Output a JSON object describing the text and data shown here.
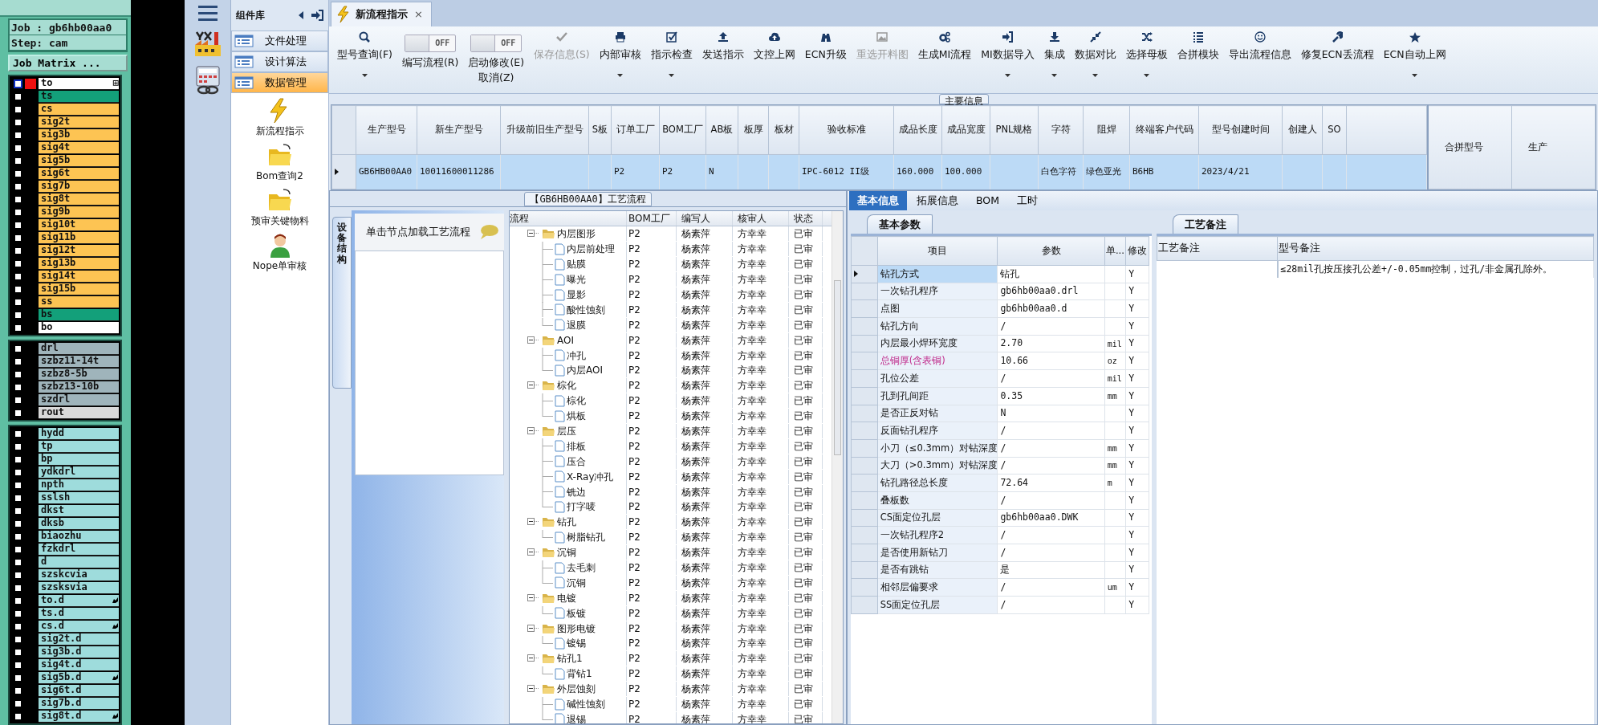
{
  "cam": {
    "job": "Job : gb6hb00aa0",
    "step": "Step: cam",
    "matrix_button": "Job Matrix ...",
    "layer_groups": [
      [
        {
          "name": "to",
          "color": "#ffffff",
          "checked": false,
          "active": true,
          "marked": false,
          "expand": "⊞"
        },
        {
          "name": "ts",
          "color": "#13a07a",
          "checked": false,
          "active": false,
          "marked": false
        },
        {
          "name": "cs",
          "color": "#fdc453",
          "checked": false,
          "active": false,
          "marked": false
        },
        {
          "name": "sig2t",
          "color": "#fdc453",
          "checked": false,
          "active": false,
          "marked": false
        },
        {
          "name": "sig3b",
          "color": "#fdc453",
          "checked": false,
          "active": false,
          "marked": false
        },
        {
          "name": "sig4t",
          "color": "#fdc453",
          "checked": false,
          "active": false,
          "marked": false
        },
        {
          "name": "sig5b",
          "color": "#fdc453",
          "checked": false,
          "active": false,
          "marked": false
        },
        {
          "name": "sig6t",
          "color": "#fdc453",
          "checked": false,
          "active": false,
          "marked": false
        },
        {
          "name": "sig7b",
          "color": "#fdc453",
          "checked": false,
          "active": false,
          "marked": false
        },
        {
          "name": "sig8t",
          "color": "#fdc453",
          "checked": false,
          "active": false,
          "marked": false
        },
        {
          "name": "sig9b",
          "color": "#fdc453",
          "checked": false,
          "active": false,
          "marked": false
        },
        {
          "name": "sig10t",
          "color": "#fdc453",
          "checked": false,
          "active": false,
          "marked": false
        },
        {
          "name": "sig11b",
          "color": "#fdc453",
          "checked": false,
          "active": false,
          "marked": false
        },
        {
          "name": "sig12t",
          "color": "#fdc453",
          "checked": false,
          "active": false,
          "marked": false
        },
        {
          "name": "sig13b",
          "color": "#fdc453",
          "checked": false,
          "active": false,
          "marked": false
        },
        {
          "name": "sig14t",
          "color": "#fdc453",
          "checked": false,
          "active": false,
          "marked": false
        },
        {
          "name": "sig15b",
          "color": "#fdc453",
          "checked": false,
          "active": false,
          "marked": false
        },
        {
          "name": "ss",
          "color": "#fdc453",
          "checked": false,
          "active": false,
          "marked": false
        },
        {
          "name": "bs",
          "color": "#13a07a",
          "checked": false,
          "active": false,
          "marked": false
        },
        {
          "name": "bo",
          "color": "#ffffff",
          "checked": false,
          "active": false,
          "marked": false
        }
      ],
      [
        {
          "name": "drl",
          "color": "#9fb4bb",
          "checked": false,
          "active": false,
          "marked": false
        },
        {
          "name": "szbz11-14t",
          "color": "#9fb4bb",
          "checked": false,
          "active": false,
          "marked": false
        },
        {
          "name": "szbz8-5b",
          "color": "#9fb4bb",
          "checked": false,
          "active": false,
          "marked": false
        },
        {
          "name": "szbz13-10b",
          "color": "#9fb4bb",
          "checked": false,
          "active": false,
          "marked": false
        },
        {
          "name": "szdrl",
          "color": "#9fb4bb",
          "checked": false,
          "active": false,
          "marked": false
        },
        {
          "name": "rout",
          "color": "#d9d9d9",
          "checked": false,
          "active": false,
          "marked": false
        }
      ],
      [
        {
          "name": "hydd",
          "color": "#9edcdc",
          "checked": false,
          "active": false,
          "marked": false
        },
        {
          "name": "tp",
          "color": "#9edcdc",
          "checked": false,
          "active": false,
          "marked": false
        },
        {
          "name": "bp",
          "color": "#9edcdc",
          "checked": false,
          "active": false,
          "marked": false
        },
        {
          "name": "ydkdrl",
          "color": "#9edcdc",
          "checked": false,
          "active": false,
          "marked": false
        },
        {
          "name": "npth",
          "color": "#9edcdc",
          "checked": false,
          "active": false,
          "marked": false
        },
        {
          "name": "sslsh",
          "color": "#9edcdc",
          "checked": false,
          "active": false,
          "marked": false
        },
        {
          "name": "dkst",
          "color": "#9edcdc",
          "checked": false,
          "active": false,
          "marked": false
        },
        {
          "name": "dksb",
          "color": "#9edcdc",
          "checked": false,
          "active": false,
          "marked": false
        },
        {
          "name": "biaozhu",
          "color": "#9edcdc",
          "checked": false,
          "active": false,
          "marked": false
        },
        {
          "name": "fzkdrl",
          "color": "#9edcdc",
          "checked": false,
          "active": false,
          "marked": false
        },
        {
          "name": "d",
          "color": "#9edcdc",
          "checked": false,
          "active": false,
          "marked": false
        },
        {
          "name": "szskcvia",
          "color": "#9edcdc",
          "checked": false,
          "active": false,
          "marked": false
        },
        {
          "name": "szsksvia",
          "color": "#9edcdc",
          "checked": false,
          "active": false,
          "marked": false
        },
        {
          "name": "to.d",
          "color": "#9edcdc",
          "checked": false,
          "active": false,
          "marked": true
        },
        {
          "name": "ts.d",
          "color": "#9edcdc",
          "checked": false,
          "active": false,
          "marked": false
        },
        {
          "name": "cs.d",
          "color": "#9edcdc",
          "checked": false,
          "active": false,
          "marked": true
        },
        {
          "name": "sig2t.d",
          "color": "#9edcdc",
          "checked": false,
          "active": false,
          "marked": false
        },
        {
          "name": "sig3b.d",
          "color": "#9edcdc",
          "checked": false,
          "active": false,
          "marked": false
        },
        {
          "name": "sig4t.d",
          "color": "#9edcdc",
          "checked": false,
          "active": false,
          "marked": false
        },
        {
          "name": "sig5b.d",
          "color": "#9edcdc",
          "checked": false,
          "active": false,
          "marked": true
        },
        {
          "name": "sig6t.d",
          "color": "#9edcdc",
          "checked": false,
          "active": false,
          "marked": false
        },
        {
          "name": "sig7b.d",
          "color": "#9edcdc",
          "checked": false,
          "active": false,
          "marked": false
        },
        {
          "name": "sig8t.d",
          "color": "#9edcdc",
          "checked": false,
          "active": false,
          "marked": true
        }
      ]
    ]
  },
  "component_library": {
    "title": "组件库",
    "categories": [
      {
        "label": "文件处理",
        "selected": false
      },
      {
        "label": "设计算法",
        "selected": false
      },
      {
        "label": "数据管理",
        "selected": true
      }
    ],
    "modules": [
      {
        "label": "新流程指示"
      },
      {
        "label": "Bom查询2"
      },
      {
        "label": "预审关键物料"
      },
      {
        "label": "Nope单审核"
      }
    ]
  },
  "tabs": [
    {
      "label": "新流程指示",
      "selected": true,
      "close": "×"
    }
  ],
  "toolbar": [
    {
      "kind": "button",
      "label": "型号查询(F)",
      "dropdown": true,
      "disabled": false
    },
    {
      "kind": "toggle",
      "label": "编写流程(R)",
      "switch_text": "OFF",
      "on": false
    },
    {
      "kind": "toggle",
      "label": "启动修改(E)",
      "label2": "取消(Z)",
      "switch_text": "OFF",
      "on": false
    },
    {
      "kind": "button",
      "label": "保存信息(S)",
      "dropdown": false,
      "disabled": true
    },
    {
      "kind": "button",
      "label": "内部审核",
      "dropdown": true,
      "disabled": false
    },
    {
      "kind": "button",
      "label": "指示检查",
      "dropdown": true,
      "disabled": false
    },
    {
      "kind": "button",
      "label": "发送指示",
      "dropdown": false,
      "disabled": false
    },
    {
      "kind": "button",
      "label": "文控上网",
      "dropdown": false,
      "disabled": false
    },
    {
      "kind": "button",
      "label": "ECN升级",
      "dropdown": false,
      "disabled": false
    },
    {
      "kind": "button",
      "label": "重选开料图",
      "dropdown": false,
      "disabled": true
    },
    {
      "kind": "button",
      "label": "生成MI流程",
      "dropdown": false,
      "disabled": false
    },
    {
      "kind": "button",
      "label": "MI数据导入",
      "dropdown": true,
      "disabled": false
    },
    {
      "kind": "button",
      "label": "集成",
      "dropdown": true,
      "disabled": false
    },
    {
      "kind": "button",
      "label": "数据对比",
      "dropdown": true,
      "disabled": false
    },
    {
      "kind": "button",
      "label": "选择母板",
      "dropdown": true,
      "disabled": false
    },
    {
      "kind": "button",
      "label": "合拼模块",
      "dropdown": false,
      "disabled": false
    },
    {
      "kind": "button",
      "label": "导出流程信息",
      "dropdown": false,
      "disabled": false
    },
    {
      "kind": "button",
      "label": "修复ECN丢流程",
      "dropdown": false,
      "disabled": false
    },
    {
      "kind": "button",
      "label": "ECN自动上网",
      "dropdown": true,
      "disabled": false
    }
  ],
  "main_info": {
    "title": "主要信息",
    "columns": [
      "生产型号",
      "新生产型号",
      "升级前旧生产型号",
      "S板",
      "订单工厂",
      "BOM工厂",
      "AB板",
      "板厚",
      "板材",
      "验收标准",
      "成品长度",
      "成品宽度",
      "PNL规格",
      "字符",
      "阻焊",
      "终端客户代码",
      "型号创建时间",
      "创建人",
      "SO"
    ],
    "rows": [
      {
        "selected": true,
        "cells": [
          "GB6HB00AA0",
          "10011600011286",
          "",
          "",
          "P2",
          "P2",
          "N",
          "",
          "",
          "IPC-6012 II级",
          "160.000",
          "100.000",
          "",
          "白色字符",
          "绿色亚光",
          "B6HB",
          "2023/4/21",
          "",
          ""
        ]
      }
    ],
    "side_columns": [
      "合拼型号",
      "生产"
    ]
  },
  "process": {
    "title": "【GB6HB00AA0】工艺流程",
    "side_tab": "设备结构",
    "hint": "单击节点加载工艺流程",
    "columns": [
      "流程",
      "BOM工厂",
      "编写人",
      "核审人",
      "状态"
    ],
    "tree": [
      {
        "name": "内层图形",
        "bom": "P2",
        "writer": "杨素萍",
        "reviewer": "方幸幸",
        "status": "已审",
        "expanded": true,
        "children": [
          {
            "name": "内层前处理",
            "bom": "P2",
            "writer": "杨素萍",
            "reviewer": "方幸幸",
            "status": "已审"
          },
          {
            "name": "贴膜",
            "bom": "P2",
            "writer": "杨素萍",
            "reviewer": "方幸幸",
            "status": "已审"
          },
          {
            "name": "曝光",
            "bom": "P2",
            "writer": "杨素萍",
            "reviewer": "方幸幸",
            "status": "已审"
          },
          {
            "name": "显影",
            "bom": "P2",
            "writer": "杨素萍",
            "reviewer": "方幸幸",
            "status": "已审"
          },
          {
            "name": "酸性蚀刻",
            "bom": "P2",
            "writer": "杨素萍",
            "reviewer": "方幸幸",
            "status": "已审"
          },
          {
            "name": "退膜",
            "bom": "P2",
            "writer": "杨素萍",
            "reviewer": "方幸幸",
            "status": "已审"
          }
        ]
      },
      {
        "name": "AOI",
        "bom": "P2",
        "writer": "杨素萍",
        "reviewer": "方幸幸",
        "status": "已审",
        "expanded": true,
        "children": [
          {
            "name": "冲孔",
            "bom": "P2",
            "writer": "杨素萍",
            "reviewer": "方幸幸",
            "status": "已审"
          },
          {
            "name": "内层AOI",
            "bom": "P2",
            "writer": "杨素萍",
            "reviewer": "方幸幸",
            "status": "已审"
          }
        ]
      },
      {
        "name": "棕化",
        "bom": "P2",
        "writer": "杨素萍",
        "reviewer": "方幸幸",
        "status": "已审",
        "expanded": true,
        "children": [
          {
            "name": "棕化",
            "bom": "P2",
            "writer": "杨素萍",
            "reviewer": "方幸幸",
            "status": "已审"
          },
          {
            "name": "烘板",
            "bom": "P2",
            "writer": "杨素萍",
            "reviewer": "方幸幸",
            "status": "已审"
          }
        ]
      },
      {
        "name": "层压",
        "bom": "P2",
        "writer": "杨素萍",
        "reviewer": "方幸幸",
        "status": "已审",
        "expanded": true,
        "children": [
          {
            "name": "排板",
            "bom": "P2",
            "writer": "杨素萍",
            "reviewer": "方幸幸",
            "status": "已审"
          },
          {
            "name": "压合",
            "bom": "P2",
            "writer": "杨素萍",
            "reviewer": "方幸幸",
            "status": "已审"
          },
          {
            "name": "X-Ray冲孔",
            "bom": "P2",
            "writer": "杨素萍",
            "reviewer": "方幸幸",
            "status": "已审"
          },
          {
            "name": "铣边",
            "bom": "P2",
            "writer": "杨素萍",
            "reviewer": "方幸幸",
            "status": "已审"
          },
          {
            "name": "打字唛",
            "bom": "P2",
            "writer": "杨素萍",
            "reviewer": "方幸幸",
            "status": "已审"
          }
        ]
      },
      {
        "name": "钻孔",
        "bom": "P2",
        "writer": "杨素萍",
        "reviewer": "方幸幸",
        "status": "已审",
        "expanded": true,
        "children": [
          {
            "name": "树脂钻孔",
            "bom": "P2",
            "writer": "杨素萍",
            "reviewer": "方幸幸",
            "status": "已审"
          }
        ]
      },
      {
        "name": "沉铜",
        "bom": "P2",
        "writer": "杨素萍",
        "reviewer": "方幸幸",
        "status": "已审",
        "expanded": true,
        "children": [
          {
            "name": "去毛刺",
            "bom": "P2",
            "writer": "杨素萍",
            "reviewer": "方幸幸",
            "status": "已审"
          },
          {
            "name": "沉铜",
            "bom": "P2",
            "writer": "杨素萍",
            "reviewer": "方幸幸",
            "status": "已审"
          }
        ]
      },
      {
        "name": "电镀",
        "bom": "P2",
        "writer": "杨素萍",
        "reviewer": "方幸幸",
        "status": "已审",
        "expanded": true,
        "children": [
          {
            "name": "板镀",
            "bom": "P2",
            "writer": "杨素萍",
            "reviewer": "方幸幸",
            "status": "已审"
          }
        ]
      },
      {
        "name": "图形电镀",
        "bom": "P2",
        "writer": "杨素萍",
        "reviewer": "方幸幸",
        "status": "已审",
        "expanded": true,
        "children": [
          {
            "name": "镀锡",
            "bom": "P2",
            "writer": "杨素萍",
            "reviewer": "方幸幸",
            "status": "已审"
          }
        ]
      },
      {
        "name": "钻孔1",
        "bom": "P2",
        "writer": "杨素萍",
        "reviewer": "方幸幸",
        "status": "已审",
        "expanded": true,
        "children": [
          {
            "name": "背钻1",
            "bom": "P2",
            "writer": "杨素萍",
            "reviewer": "方幸幸",
            "status": "已审"
          }
        ]
      },
      {
        "name": "外层蚀刻",
        "bom": "P2",
        "writer": "杨素萍",
        "reviewer": "方幸幸",
        "status": "已审",
        "expanded": true,
        "children": [
          {
            "name": "碱性蚀刻",
            "bom": "P2",
            "writer": "杨素萍",
            "reviewer": "方幸幸",
            "status": "已审"
          },
          {
            "name": "退锡",
            "bom": "P2",
            "writer": "杨素萍",
            "reviewer": "方幸幸",
            "status": "已审"
          }
        ]
      }
    ]
  },
  "detail_tabs": [
    {
      "label": "基本信息",
      "selected": true
    },
    {
      "label": "拓展信息",
      "selected": false
    },
    {
      "label": "BOM",
      "selected": false
    },
    {
      "label": "工时",
      "selected": false
    }
  ],
  "params": {
    "title": "基本参数",
    "columns": [
      "项目",
      "参数",
      "单...",
      "修改"
    ],
    "rows": [
      {
        "item": "钻孔方式",
        "value": "钻孔",
        "unit": "",
        "modified": "Y",
        "selected": true,
        "highlighted": false
      },
      {
        "item": "一次钻孔程序",
        "value": "gb6hb00aa0.drl",
        "unit": "",
        "modified": "Y",
        "selected": false,
        "highlighted": false
      },
      {
        "item": "点图",
        "value": "gb6hb00aa0.d",
        "unit": "",
        "modified": "Y",
        "selected": false,
        "highlighted": false
      },
      {
        "item": "钻孔方向",
        "value": "/",
        "unit": "",
        "modified": "Y",
        "selected": false,
        "highlighted": false
      },
      {
        "item": "内层最小焊环宽度",
        "value": "2.70",
        "unit": "mil",
        "modified": "Y",
        "selected": false,
        "highlighted": false
      },
      {
        "item": "总铜厚(含表铜)",
        "value": "10.66",
        "unit": "oz",
        "modified": "Y",
        "selected": false,
        "highlighted": true
      },
      {
        "item": "孔位公差",
        "value": "/",
        "unit": "mil",
        "modified": "Y",
        "selected": false,
        "highlighted": false
      },
      {
        "item": "孔到孔间距",
        "value": "0.35",
        "unit": "mm",
        "modified": "Y",
        "selected": false,
        "highlighted": false
      },
      {
        "item": "是否正反对钻",
        "value": "N",
        "unit": "",
        "modified": "Y",
        "selected": false,
        "highlighted": false
      },
      {
        "item": "反面钻孔程序",
        "value": "/",
        "unit": "",
        "modified": "Y",
        "selected": false,
        "highlighted": false
      },
      {
        "item": "小刀（≤0.3mm）对钻深度",
        "value": "/",
        "unit": "mm",
        "modified": "Y",
        "selected": false,
        "highlighted": false
      },
      {
        "item": "大刀（>0.3mm）对钻深度",
        "value": "/",
        "unit": "mm",
        "modified": "Y",
        "selected": false,
        "highlighted": false
      },
      {
        "item": "钻孔路径总长度",
        "value": "72.64",
        "unit": "m",
        "modified": "Y",
        "selected": false,
        "highlighted": false
      },
      {
        "item": "叠板数",
        "value": "/",
        "unit": "",
        "modified": "Y",
        "selected": false,
        "highlighted": false
      },
      {
        "item": "CS面定位孔层",
        "value": "gb6hb00aa0.DWK",
        "unit": "",
        "modified": "Y",
        "selected": false,
        "highlighted": false
      },
      {
        "item": "一次钻孔程序2",
        "value": "/",
        "unit": "",
        "modified": "Y",
        "selected": false,
        "highlighted": false
      },
      {
        "item": "是否使用新钻刀",
        "value": "/",
        "unit": "",
        "modified": "Y",
        "selected": false,
        "highlighted": false
      },
      {
        "item": "是否有跳钻",
        "value": "是",
        "unit": "",
        "modified": "Y",
        "selected": false,
        "highlighted": false
      },
      {
        "item": "相邻层偏要求",
        "value": "/",
        "unit": "um",
        "modified": "Y",
        "selected": false,
        "highlighted": false
      },
      {
        "item": "SS面定位孔层",
        "value": "/",
        "unit": "",
        "modified": "Y",
        "selected": false,
        "highlighted": false
      }
    ]
  },
  "notes": {
    "title": "工艺备注",
    "columns": [
      "工艺备注",
      "型号备注"
    ],
    "rows": [
      {
        "process_note": "",
        "model_note": "≤28mil孔按压接孔公差+/-0.05mm控制，过孔/非金属孔除外。"
      }
    ]
  }
}
